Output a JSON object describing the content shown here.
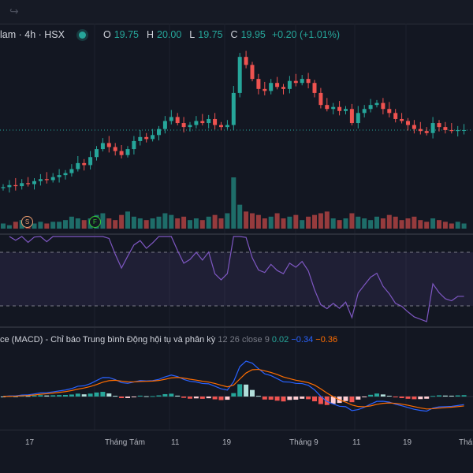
{
  "toolbar": {
    "redo_icon": "redo-arrow-icon"
  },
  "legend": {
    "symbol": "lam · 4h · HSX",
    "open_label": "O",
    "open": "19.75",
    "high_label": "H",
    "high": "20.00",
    "low_label": "L",
    "low": "19.75",
    "close_label": "C",
    "close": "19.95",
    "change": "+0.20 (+1.01%)"
  },
  "markers": [
    {
      "label": "S",
      "color": "#f0a070"
    },
    {
      "label": "F",
      "color": "#33cc33"
    }
  ],
  "macd": {
    "title": "ce (MACD) - Chỉ báo Trung bình Động hội tụ và phân kỳ",
    "params": "12 26 close 9",
    "hist": "0.02",
    "macd": "−0.34",
    "signal": "−0.36"
  },
  "time_axis": [
    "17",
    "Tháng Tám",
    "11",
    "19",
    "Tháng 9",
    "11",
    "19",
    "Thán"
  ],
  "colors": {
    "up": "#26a69a",
    "down": "#ef5350",
    "rsi": "#7e57c2",
    "macd": "#2962ff",
    "signal": "#ff6d00",
    "bg": "#131722"
  },
  "chart_data": {
    "type": "candlestick",
    "price_range": [
      16.8,
      24.0
    ],
    "closes": [
      17.1,
      17.2,
      17.15,
      17.3,
      17.25,
      17.4,
      17.5,
      17.45,
      17.6,
      17.7,
      17.8,
      18.0,
      18.3,
      18.2,
      18.6,
      19.0,
      19.3,
      19.1,
      18.9,
      18.7,
      19.0,
      19.4,
      19.6,
      19.5,
      19.7,
      20.0,
      20.4,
      20.6,
      20.3,
      20.1,
      20.2,
      20.4,
      20.3,
      20.5,
      20.2,
      20.1,
      20.2,
      21.8,
      23.6,
      23.2,
      22.5,
      22.0,
      21.9,
      22.3,
      22.1,
      22.0,
      22.4,
      22.3,
      22.5,
      22.3,
      21.8,
      21.2,
      21.0,
      21.1,
      20.9,
      21.0,
      20.3,
      20.8,
      21.0,
      21.2,
      21.3,
      21.0,
      20.8,
      20.5,
      20.4,
      20.2,
      20.0,
      19.9,
      19.8,
      20.3,
      20.1,
      19.95,
      19.9,
      19.95,
      19.95
    ],
    "volumes": [
      3,
      2,
      4,
      5,
      3,
      3,
      4,
      3,
      4,
      4,
      5,
      7,
      6,
      5,
      6,
      8,
      9,
      6,
      5,
      8,
      10,
      7,
      6,
      5,
      6,
      7,
      9,
      8,
      6,
      7,
      5,
      6,
      5,
      7,
      8,
      6,
      9,
      30,
      14,
      10,
      9,
      8,
      6,
      7,
      9,
      6,
      7,
      8,
      5,
      7,
      8,
      9,
      10,
      6,
      5,
      6,
      9,
      7,
      6,
      5,
      7,
      6,
      8,
      7,
      5,
      6,
      7,
      5,
      4,
      6,
      5,
      4,
      3,
      4,
      3
    ],
    "rsi_levels": [
      70,
      30
    ]
  }
}
